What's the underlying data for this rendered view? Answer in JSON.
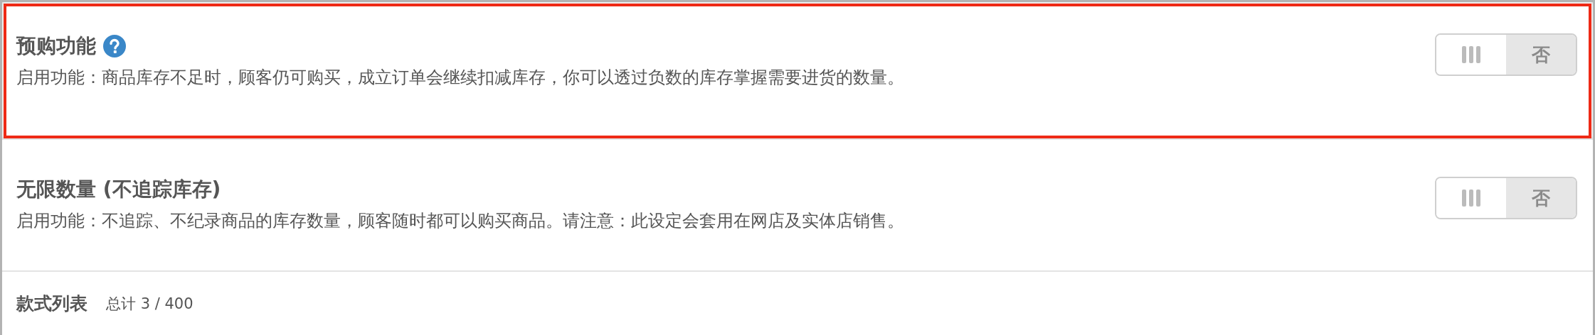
{
  "settings": [
    {
      "title": "预购功能",
      "help": true,
      "highlighted": true,
      "description": "启用功能：商品库存不足时，顾客仍可购买，成立订单会继续扣减库存，你可以透过负数的库存掌握需要进货的数量。",
      "toggle": {
        "on": false,
        "label": "否"
      }
    },
    {
      "title": "无限数量 (不追踪库存)",
      "help": false,
      "highlighted": false,
      "description": "启用功能：不追踪、不纪录商品的库存数量，顾客随时都可以购买商品。请注意：此设定会套用在网店及实体店销售。",
      "toggle": {
        "on": false,
        "label": "否"
      }
    }
  ],
  "variants": {
    "title": "款式列表",
    "count": "总计 3 / 400"
  }
}
